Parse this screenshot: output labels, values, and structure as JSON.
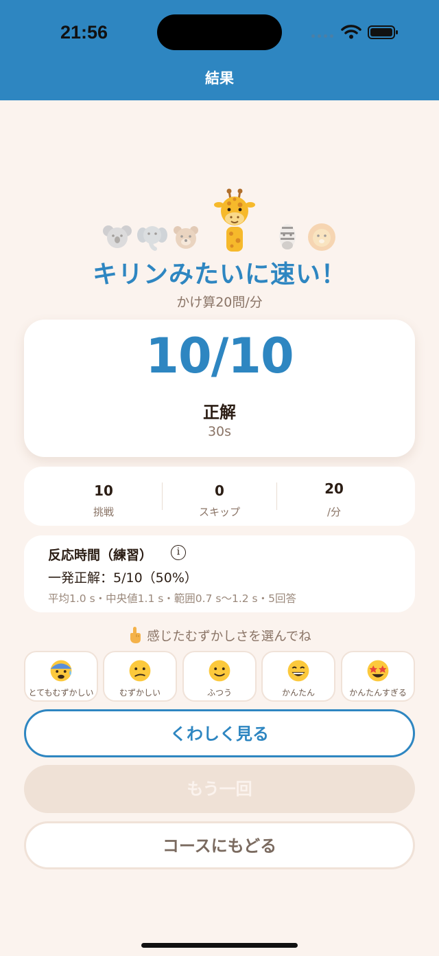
{
  "status_bar": {
    "time": "21:56"
  },
  "header": {
    "title": "結果"
  },
  "hero": {
    "title": "キリンみたいに速い！",
    "subtitle": "かけ算20問/分"
  },
  "score_card": {
    "score": "10/10",
    "label": "正解",
    "time": "30s"
  },
  "stats": [
    {
      "value": "10",
      "label": "挑戦"
    },
    {
      "value": "0",
      "label": "スキップ"
    },
    {
      "value": "20",
      "label": "/分"
    }
  ],
  "reaction": {
    "title": "反応時間（練習）",
    "info_glyph": "i",
    "main": "一発正解：5/10（50%）",
    "detail": "平均1.0 s・中央値1.1 s・範囲0.7 s〜1.2 s・5回答"
  },
  "difficulty": {
    "prompt": "感じたむずかしさを選んでね",
    "prompt_icon": "pointing-hand-icon",
    "options": [
      {
        "label": "とてもむずかしい",
        "icon": "anxious-face-icon"
      },
      {
        "label": "むずかしい",
        "icon": "confused-face-icon"
      },
      {
        "label": "ふつう",
        "icon": "slight-smile-face-icon"
      },
      {
        "label": "かんたん",
        "icon": "grinning-face-icon"
      },
      {
        "label": "かんたんすぎる",
        "icon": "star-struck-face-icon"
      }
    ]
  },
  "buttons": {
    "detail": "くわしく見る",
    "retry": "もう一回",
    "course": "コースにもどる"
  },
  "colors": {
    "accent": "#2e86c1",
    "background": "#fbf3ee",
    "muted_text": "#8a7466"
  }
}
